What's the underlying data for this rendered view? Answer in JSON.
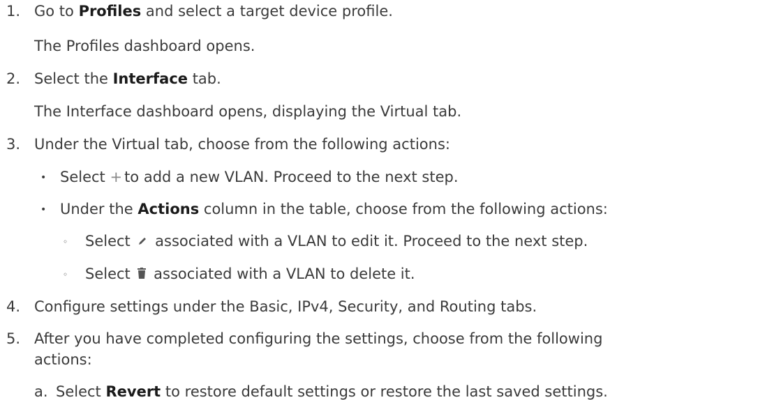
{
  "steps": [
    {
      "num": "1.",
      "pre": "Go to ",
      "bold": "Profiles",
      "post": " and select a target device profile.",
      "result": "The Profiles dashboard opens."
    },
    {
      "num": "2.",
      "pre": "Select the ",
      "bold": "Interface",
      "post": " tab.",
      "result": "The Interface dashboard opens, displaying the Virtual tab."
    },
    {
      "num": "3.",
      "text": "Under the Virtual tab, choose from the following actions:",
      "bullets": [
        {
          "pre": "Select ",
          "post": "to add a new VLAN. Proceed to the next step.",
          "icon": "plus-icon"
        },
        {
          "pre": "Under the ",
          "bold": "Actions",
          "post": " column in the table, choose from the following actions:",
          "sub": [
            {
              "pre": "Select ",
              "post": " associated with a VLAN to edit it. Proceed to the next step.",
              "icon": "pencil-icon"
            },
            {
              "pre": "Select ",
              "post": " associated with a VLAN to delete it.",
              "icon": "trash-icon"
            }
          ]
        }
      ]
    },
    {
      "num": "4.",
      "text": "Configure settings under the Basic, IPv4, Security, and Routing tabs."
    },
    {
      "num": "5.",
      "text": "After you have completed configuring the settings, choose from the following",
      "text2": "actions:",
      "alpha": [
        {
          "letter": "a.",
          "pre": "Select ",
          "bold": "Revert",
          "post": " to restore default settings or restore the last saved settings."
        }
      ]
    }
  ]
}
